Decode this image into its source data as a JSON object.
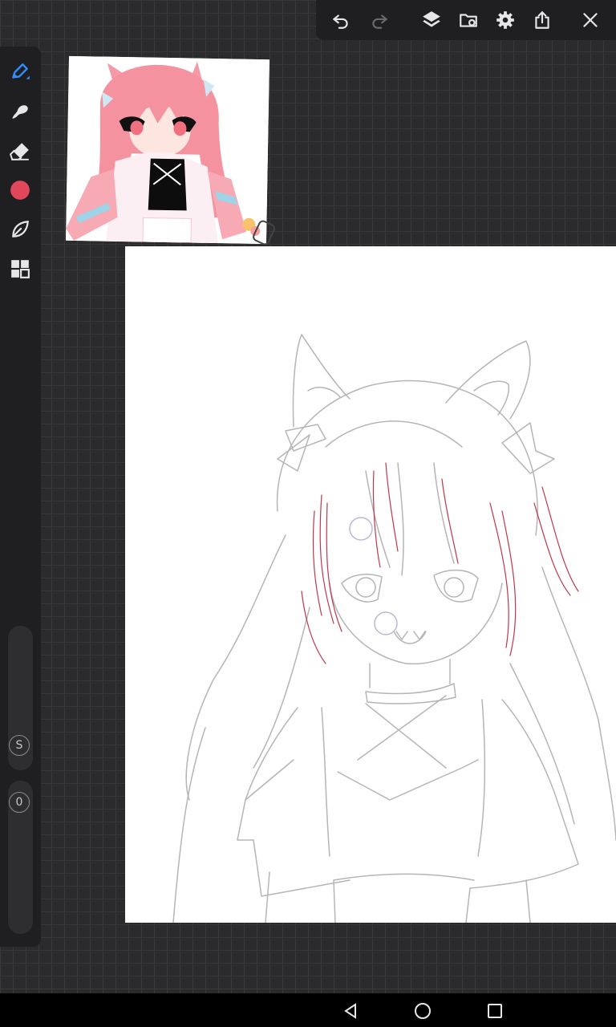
{
  "toolbar": {
    "buttons": [
      {
        "name": "undo",
        "icon": "undo-icon",
        "enabled": true
      },
      {
        "name": "redo",
        "icon": "redo-icon",
        "enabled": false
      },
      {
        "name": "layers",
        "icon": "layers-icon",
        "enabled": true
      },
      {
        "name": "file",
        "icon": "folder-icon",
        "enabled": true
      },
      {
        "name": "settings",
        "icon": "gear-icon",
        "enabled": true
      },
      {
        "name": "share",
        "icon": "share-icon",
        "enabled": true
      },
      {
        "name": "close",
        "icon": "close-icon",
        "enabled": true
      }
    ]
  },
  "sidebar": {
    "tools": [
      {
        "name": "pen",
        "icon": "pen-icon",
        "active": true
      },
      {
        "name": "smudge",
        "icon": "smudge-icon",
        "active": false
      },
      {
        "name": "eraser",
        "icon": "eraser-icon",
        "active": false
      },
      {
        "name": "color",
        "icon": "color-swatch-icon",
        "active": false
      },
      {
        "name": "brush-library",
        "icon": "leaf-icon",
        "active": false
      },
      {
        "name": "more",
        "icon": "grid-icon",
        "active": false
      }
    ],
    "size_label": "S",
    "opacity_label": "0",
    "current_color": "#e0475a",
    "accent_color": "#2f8fff"
  },
  "reference": {
    "description_icon": "reference-image"
  },
  "canvas": {
    "sketch_line_color": "#b5b5b8",
    "hair_line_color": "#c0364a"
  },
  "navbar": {
    "buttons": [
      {
        "name": "back",
        "icon": "triangle-back-icon"
      },
      {
        "name": "home",
        "icon": "circle-home-icon"
      },
      {
        "name": "recents",
        "icon": "square-recents-icon"
      }
    ]
  }
}
